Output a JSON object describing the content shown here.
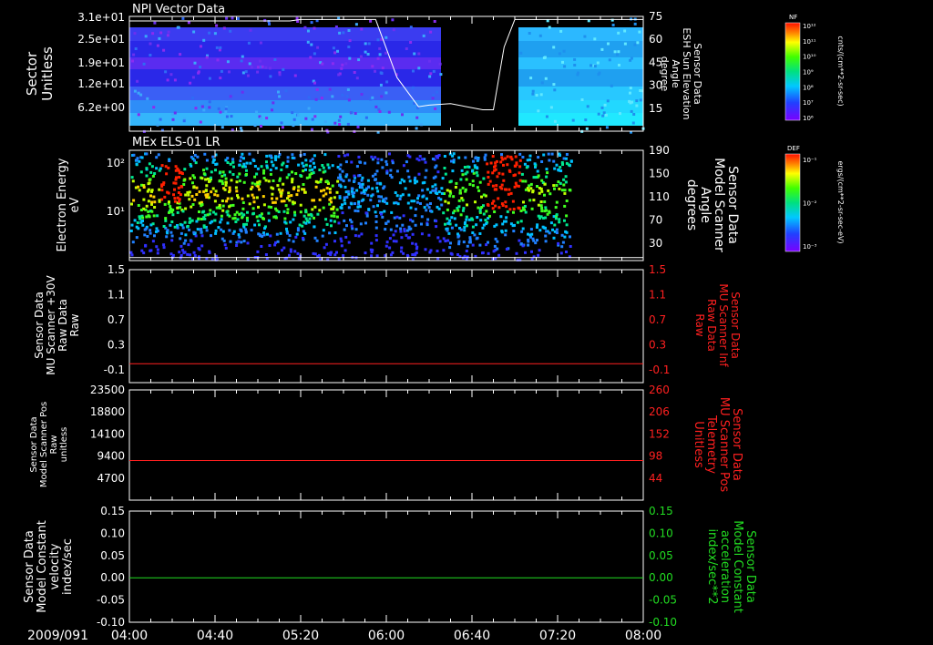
{
  "date_label": "2009/091",
  "time_ticks": [
    "04:00",
    "04:40",
    "05:20",
    "06:00",
    "06:40",
    "07:20",
    "08:00"
  ],
  "chart_data": [
    {
      "type": "heatmap",
      "title": "NPI Vector Data",
      "left_axis": {
        "label": [
          "Sector",
          "Unitless"
        ],
        "ticks": [
          "3.1e+01",
          "2.5e+01",
          "1.9e+01",
          "1.2e+01",
          "6.2e+00"
        ]
      },
      "right_axis": {
        "label": [
          "Sensor Data",
          "ESH Sun Elevation",
          "Angle",
          "degree"
        ],
        "ticks": [
          "75",
          "60",
          "45",
          "30",
          "15"
        ],
        "range": [
          0,
          75
        ]
      },
      "overlay_line": {
        "color": "#ffffff",
        "x": [
          "04:00",
          "05:15",
          "05:20",
          "05:55",
          "06:05",
          "06:15",
          "06:20",
          "06:30",
          "06:45",
          "06:50",
          "06:55",
          "07:00",
          "08:00"
        ],
        "y": [
          72,
          72,
          73,
          73,
          35,
          16,
          17,
          18,
          14,
          14,
          55,
          73,
          73
        ]
      },
      "colorbar": {
        "label": "NF",
        "unit": "cnts/(cm**2-sr-sec)",
        "ticks": [
          "10¹²",
          "10¹¹",
          "10¹⁰",
          "10⁹",
          "10⁸",
          "10⁷",
          "10⁶"
        ]
      }
    },
    {
      "type": "heatmap",
      "title": "MEx ELS-01 LR",
      "left_axis": {
        "label": [
          "Electron Energy",
          "eV"
        ],
        "ticks": [
          "10²",
          "10¹"
        ],
        "scale": "log"
      },
      "right_axis": {
        "label": [
          "Sensor Data",
          "Model Scanner",
          "Angle",
          "degrees"
        ],
        "ticks": [
          "190",
          "150",
          "110",
          "70",
          "30"
        ],
        "range": [
          0,
          190
        ]
      },
      "overlay_line": {
        "color": "#ffffff",
        "x": [
          "04:00",
          "08:00"
        ],
        "y": [
          5,
          5
        ]
      },
      "colorbar": {
        "label": "DEF",
        "unit": "ergs/(cm**2-sr-sec-eV)",
        "ticks": [
          "10⁻¹",
          "10⁻²",
          "10⁻³"
        ]
      }
    },
    {
      "type": "line",
      "left_axis": {
        "label": [
          "Sensor Data",
          "MU Scanner +30V",
          "Raw Data",
          "Raw"
        ],
        "ticks": [
          "1.5",
          "1.1",
          "0.7",
          "0.3",
          "-0.1"
        ],
        "range": [
          -0.3,
          1.5
        ]
      },
      "right_axis": {
        "label": [
          "Sensor Data",
          "MU Scanner Inf",
          "Raw Data",
          "Raw"
        ],
        "ticks": [
          "1.5",
          "1.1",
          "0.7",
          "0.3",
          "-0.1"
        ],
        "range": [
          -0.3,
          1.5
        ],
        "color": "#ff2020"
      },
      "series": [
        {
          "color": "#ff2020",
          "x": [
            "04:00",
            "08:00"
          ],
          "y": [
            0.0,
            0.0
          ]
        }
      ]
    },
    {
      "type": "line",
      "left_axis": {
        "label": [
          "Sensor Data",
          "Model Scanner Pos",
          "Raw",
          "unitless"
        ],
        "ticks": [
          "23500",
          "18800",
          "14100",
          "9400",
          "4700"
        ],
        "range": [
          0,
          23500
        ]
      },
      "right_axis": {
        "label": [
          "Sensor Data",
          "MU Scanner Pos",
          "Telemetry",
          "Unitless"
        ],
        "ticks": [
          "260",
          "206",
          "152",
          "98",
          "44"
        ],
        "range": [
          -10,
          260
        ],
        "color": "#ff2020"
      },
      "series": [
        {
          "color": "#ff2020",
          "x": [
            "04:00",
            "08:00"
          ],
          "y": [
            87,
            87
          ]
        }
      ]
    },
    {
      "type": "line",
      "left_axis": {
        "label": [
          "Sensor Data",
          "Model Constant",
          "velocity",
          "index/sec"
        ],
        "ticks": [
          "0.15",
          "0.10",
          "0.05",
          "0.00",
          "-0.05",
          "-0.10"
        ],
        "range": [
          -0.1,
          0.15
        ]
      },
      "right_axis": {
        "label": [
          "Sensor Data",
          "Model Constant",
          "acceleration",
          "index/sec**2"
        ],
        "ticks": [
          "0.15",
          "0.10",
          "0.05",
          "0.00",
          "-0.05",
          "-0.10"
        ],
        "range": [
          -0.1,
          0.15
        ],
        "color": "#22dd22"
      },
      "series": [
        {
          "color": "#22dd22",
          "x": [
            "04:00",
            "08:00"
          ],
          "y": [
            0.0,
            0.0
          ]
        }
      ]
    }
  ]
}
